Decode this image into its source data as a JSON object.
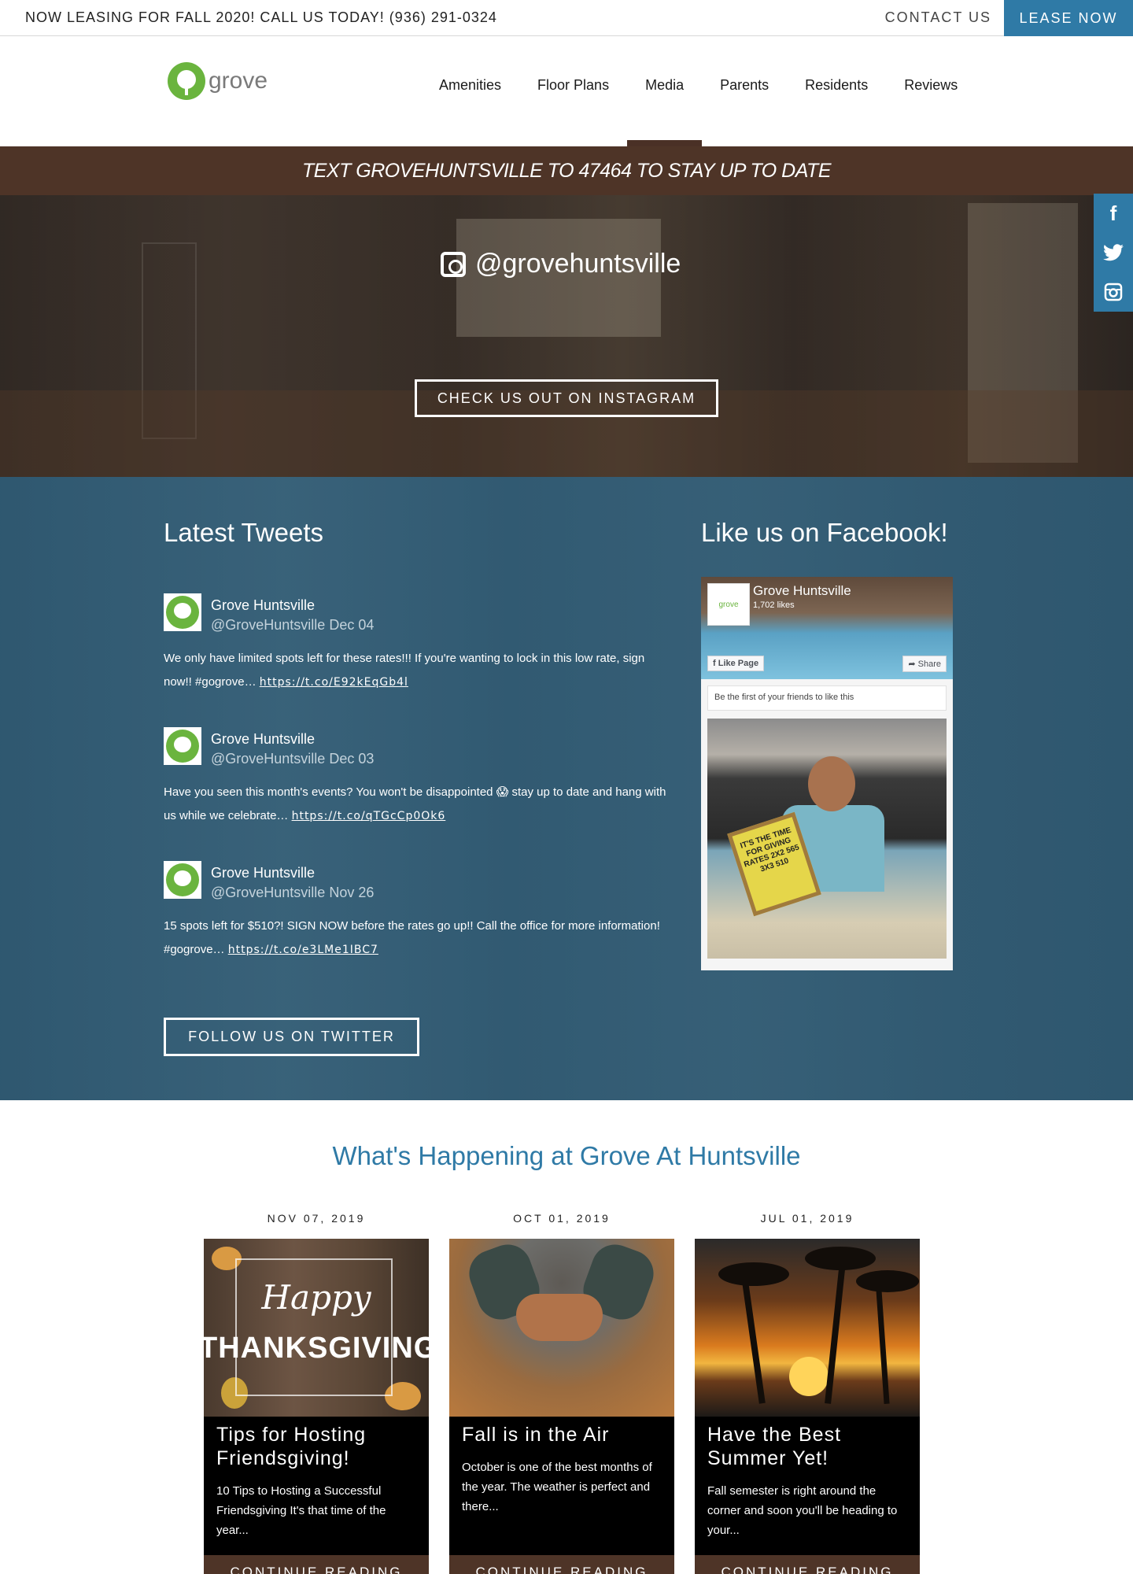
{
  "topbar": {
    "promo": "NOW LEASING FOR FALL 2020! CALL US TODAY! (936) 291-0324",
    "contact": "CONTACT US",
    "lease": "LEASE NOW"
  },
  "header": {
    "logo_text": "grove",
    "nav": [
      "Amenities",
      "Floor Plans",
      "Media",
      "Parents",
      "Residents",
      "Reviews"
    ],
    "active_nav": "Media"
  },
  "banner": {
    "text": "TEXT GROVEHUNTSVILLE TO 47464 TO STAY UP TO DATE"
  },
  "instagram": {
    "handle": "@grovehuntsville",
    "button": "CHECK US OUT ON INSTAGRAM"
  },
  "social": {
    "icons": [
      "facebook-icon",
      "twitter-icon",
      "instagram-icon"
    ]
  },
  "tweets": {
    "title": "Latest Tweets",
    "items": [
      {
        "name": "Grove Huntsville",
        "handle": "@GroveHuntsville",
        "date": "Dec 04",
        "text": "We only have limited spots left for these rates!!! If you're wanting to lock in this low rate, sign now!! #gogrove… ",
        "link": "https://t.co/E92kEqGb4l"
      },
      {
        "name": "Grove Huntsville",
        "handle": "@GroveHuntsville",
        "date": "Dec 03",
        "text": "Have you seen this month's events? You won't be disappointed 😱 stay up to date and hang with us while we celebrate… ",
        "link": "https://t.co/qTGcCp0Ok6"
      },
      {
        "name": "Grove Huntsville",
        "handle": "@GroveHuntsville",
        "date": "Nov 26",
        "text": "15 spots left for $510?! SIGN NOW before the rates go up!! Call the office for more information! #gogrove… ",
        "link": "https://t.co/e3LMe1IBC7"
      }
    ],
    "follow_button": "FOLLOW US ON TWITTER"
  },
  "facebook": {
    "title": "Like us on Facebook!",
    "page_name": "Grove Huntsville",
    "likes": "1,702 likes",
    "like_button": "Like Page",
    "share_button": "Share",
    "friends_text": "Be the first of your friends to like this",
    "sign_text": "IT'S THE TIME FOR GIVING RATES 2X2 565 3X3 510"
  },
  "happening": {
    "title": "What's Happening at Grove At Huntsville",
    "cards": [
      {
        "date": "NOV 07, 2019",
        "title": "Tips for Hosting Friendsgiving!",
        "desc": "10 Tips to Hosting a Successful Friendsgiving   It's that time of the year...",
        "more": "CONTINUE READING",
        "image_text_1": "Happy",
        "image_text_2": "THANKSGIVING"
      },
      {
        "date": "OCT 01, 2019",
        "title": "Fall is in the Air",
        "desc": "October is one of the best months of the year. The weather is perfect and there...",
        "more": "CONTINUE READING"
      },
      {
        "date": "JUL 01, 2019",
        "title": "Have the Best Summer Yet!",
        "desc": "Fall semester is right around the corner and soon you'll be heading to your...",
        "more": "CONTINUE READING"
      }
    ]
  },
  "colors": {
    "accent_blue": "#2f7aa6",
    "brand_brown": "#4e3427",
    "brand_green": "#6ab43e"
  }
}
